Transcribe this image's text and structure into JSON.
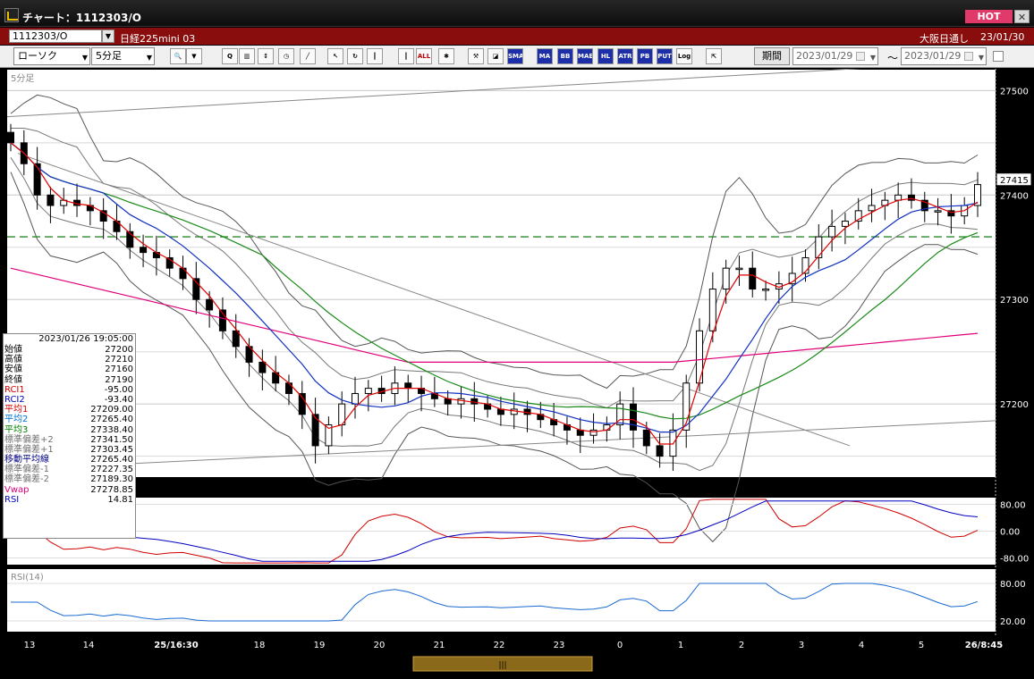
{
  "window": {
    "title": "チャート：1112303/O",
    "hot_label": "HOT",
    "close_label": "✕"
  },
  "symbol_bar": {
    "symbol_code": "1112303/O",
    "symbol_name": "日経225mini 03",
    "market": "大阪日通し",
    "date": "23/01/30"
  },
  "toolbar": {
    "chart_type": "ローソク",
    "interval": "5分足",
    "buttons": [
      {
        "name": "search-icon",
        "label": "🔍"
      },
      {
        "name": "lookup-icon",
        "label": "▼"
      },
      {
        "name": "zoom-icon",
        "label": "Q"
      },
      {
        "name": "bar-chart-icon",
        "label": "▥"
      },
      {
        "name": "bidask-icon",
        "label": "↕"
      },
      {
        "name": "clock-icon",
        "label": "◷"
      },
      {
        "name": "draw-line-icon",
        "label": "╱"
      },
      {
        "name": "pointer-icon",
        "label": "↖"
      },
      {
        "name": "redo-icon",
        "label": "↻"
      },
      {
        "name": "candle-icon",
        "label": "┃"
      },
      {
        "name": "candle-color-icon",
        "label": "┃"
      },
      {
        "name": "all-button",
        "label": "ALL"
      },
      {
        "name": "tools-icon",
        "label": "✱"
      },
      {
        "name": "settings-icon",
        "label": "⚒"
      },
      {
        "name": "color-palette-icon",
        "label": "◪"
      },
      {
        "name": "indicator-sma",
        "label": "SMA"
      },
      {
        "name": "indicator-ma",
        "label": "MA"
      },
      {
        "name": "indicator-bb",
        "label": "BB"
      },
      {
        "name": "indicator-mae",
        "label": "MAE"
      },
      {
        "name": "indicator-hl",
        "label": "HL"
      },
      {
        "name": "indicator-atr",
        "label": "ATR"
      },
      {
        "name": "indicator-pb",
        "label": "PB"
      },
      {
        "name": "indicator-put",
        "label": "PUT"
      },
      {
        "name": "log-button",
        "label": "Log"
      },
      {
        "name": "export-icon",
        "label": "⇱"
      }
    ],
    "period_label": "期間",
    "date_from": "2023/01/29",
    "date_to": "2023/01/29",
    "tilde": "～"
  },
  "chart": {
    "timeframe_label": "5分足",
    "price_axis": [
      "27500",
      "27400",
      "27300",
      "27200"
    ],
    "current_price": "27415",
    "rci_axis": [
      "80.00",
      "0.00",
      "-80.00"
    ],
    "rsi_label": "RSI(14)",
    "rsi_axis": [
      "80.00",
      "20.00"
    ],
    "x_axis": [
      "13",
      "14",
      "25/16:30",
      "18",
      "19",
      "20",
      "21",
      "22",
      "23",
      "0",
      "1",
      "2",
      "3",
      "4",
      "5",
      "26/8:45"
    ]
  },
  "data_panel": {
    "datetime": "2023/01/26 19:05:00",
    "rows": [
      {
        "label": "始値",
        "value": "27200",
        "color": "#000000"
      },
      {
        "label": "高値",
        "value": "27210",
        "color": "#000000"
      },
      {
        "label": "安値",
        "value": "27160",
        "color": "#000000"
      },
      {
        "label": "終値",
        "value": "27190",
        "color": "#000000"
      },
      {
        "label": "RCI1",
        "value": "-95.00",
        "color": "#d00000"
      },
      {
        "label": "RCI2",
        "value": "-93.40",
        "color": "#0000c0"
      },
      {
        "label": "平均1",
        "value": "27209.00",
        "color": "#d00000"
      },
      {
        "label": "平均2",
        "value": "27265.40",
        "color": "#0070d0"
      },
      {
        "label": "平均3",
        "value": "27338.40",
        "color": "#008000"
      },
      {
        "label": "標準偏差+2",
        "value": "27341.50",
        "color": "#707070"
      },
      {
        "label": "標準偏差+1",
        "value": "27303.45",
        "color": "#707070"
      },
      {
        "label": "移動平均線",
        "value": "27265.40",
        "color": "#000080"
      },
      {
        "label": "標準偏差-1",
        "value": "27227.35",
        "color": "#707070"
      },
      {
        "label": "標準偏差-2",
        "value": "27189.30",
        "color": "#707070"
      },
      {
        "label": "Vwap",
        "value": "27278.85",
        "color": "#e0007a"
      },
      {
        "label": "RSI",
        "value": "14.81",
        "color": "#0000c0"
      }
    ]
  },
  "chart_data": {
    "type": "line",
    "price_range": [
      27130,
      27520
    ],
    "price_ticks": [
      27500,
      27400,
      27300,
      27200
    ],
    "dashed_level": 27360,
    "x_tick_labels": [
      "13",
      "14",
      "25/16:30",
      "18",
      "19",
      "20",
      "21",
      "22",
      "23",
      "0",
      "1",
      "2",
      "3",
      "4",
      "5",
      "26/8:45"
    ],
    "closes": [
      27450,
      27430,
      27400,
      27390,
      27395,
      27390,
      27385,
      27375,
      27365,
      27350,
      27345,
      27340,
      27330,
      27320,
      27300,
      27290,
      27270,
      27255,
      27240,
      27230,
      27220,
      27210,
      27190,
      27160,
      27180,
      27200,
      27210,
      27215,
      27210,
      27220,
      27215,
      27210,
      27205,
      27200,
      27205,
      27200,
      27195,
      27190,
      27195,
      27190,
      27185,
      27180,
      27175,
      27170,
      27175,
      27180,
      27200,
      27175,
      27160,
      27150,
      27175,
      27220,
      27270,
      27310,
      27330,
      27330,
      27310,
      27310,
      27315,
      27325,
      27340,
      27360,
      27370,
      27375,
      27385,
      27390,
      27395,
      27400,
      27395,
      27385,
      27385,
      27380,
      27390,
      27410
    ]
  }
}
